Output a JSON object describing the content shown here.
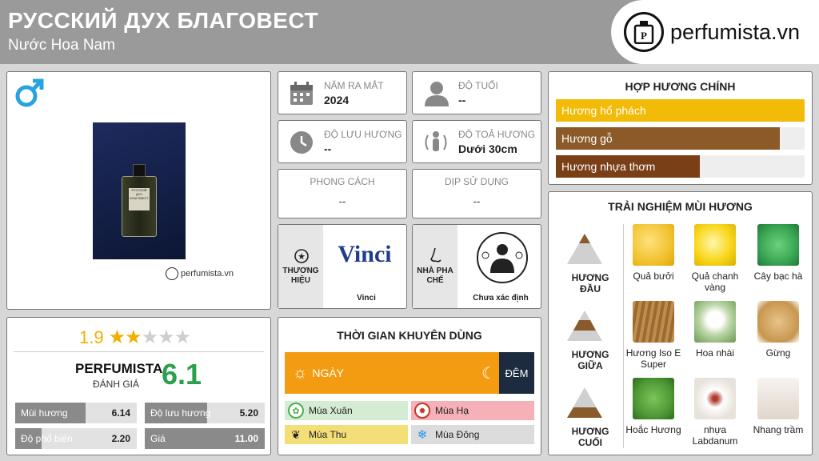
{
  "header": {
    "title": "РУССКИЙ ДУХ БЛАГОВЕСТ",
    "subtitle": "Nước Hoa Nam",
    "brand": "perfumista.vn"
  },
  "product": {
    "gender_icon": "male-symbol",
    "watermark": "perfumista.vn",
    "bottle_label": "РУССКИЙ ДУХ БЛАГОВЕСТ"
  },
  "info": {
    "release": {
      "label": "NĂM RA MẮT",
      "value": "2024"
    },
    "age": {
      "label": "ĐỘ TUỔI",
      "value": "--"
    },
    "longevity": {
      "label": "ĐỘ LƯU HƯƠNG",
      "value": "--"
    },
    "sillage": {
      "label": "ĐỘ TOẢ HƯƠNG",
      "value": "Dưới 30cm"
    },
    "style": {
      "label": "PHONG CÁCH",
      "value": "--"
    },
    "occasion": {
      "label": "DỊP SỬ DỤNG",
      "value": "--"
    },
    "brand": {
      "label": "THƯƠNG HIỆU",
      "name": "Vinci",
      "logo_text": "Vinci"
    },
    "perfumer": {
      "label": "NHÀ PHA CHẾ",
      "name": "Chưa xác định"
    }
  },
  "rating": {
    "score": "1.9",
    "stars": 1.9,
    "perfumista_label": "PERFUMISTA",
    "perfumista_sub": "ĐÁNH GIÁ",
    "perfumista_score": "6.1",
    "metrics": [
      {
        "label": "Mùi hương",
        "value": "6.14",
        "fraction": 0.614
      },
      {
        "label": "Độ lưu hương",
        "value": "5.20",
        "fraction": 0.52
      },
      {
        "label": "Độ phổ biến",
        "value": "2.20",
        "fraction": 0.22
      },
      {
        "label": "Giá",
        "value": "11.00",
        "fraction": 1.0
      }
    ]
  },
  "timing": {
    "title": "THỜI GIAN KHUYÊN DÙNG",
    "day": "NGÀY",
    "night": "ĐÊM",
    "day_fraction": 0.85,
    "seasons": [
      {
        "label": "Mùa Xuân",
        "icon": "flower-icon",
        "color": "#d4ecd4",
        "ic": "#4caf50"
      },
      {
        "label": "Mùa Hạ",
        "icon": "sun-icon",
        "color": "#f5b0b8",
        "ic": "#c0392b"
      },
      {
        "label": "Mùa Thu",
        "icon": "leaf-icon",
        "color": "#f4de78",
        "ic": "#333"
      },
      {
        "label": "Mùa Đông",
        "icon": "snowflake-icon",
        "color": "#dcdcdc",
        "ic": "#2196f3"
      }
    ]
  },
  "accords": {
    "title": "HỢP HƯƠNG CHÍNH",
    "items": [
      {
        "label": "Hương hổ phách",
        "fraction": 1.0,
        "color": "#f2bb07"
      },
      {
        "label": "Hương gỗ",
        "fraction": 0.9,
        "color": "#8c5a28"
      },
      {
        "label": "Hương nhựa thơm",
        "fraction": 0.58,
        "color": "#7a3f17"
      }
    ]
  },
  "pyramid": {
    "title": "TRẢI NGHIỆM MÙI HƯƠNG",
    "tiers": [
      {
        "label": "HƯƠNG ĐẦU",
        "notes": [
          {
            "name": "Quả bưởi",
            "color": "#f1c232"
          },
          {
            "name": "Quả chanh vàng",
            "color": "#f9d71c"
          },
          {
            "name": "Cây bạc hà",
            "color": "#3aa655"
          }
        ]
      },
      {
        "label": "HƯƠNG GIỮA",
        "notes": [
          {
            "name": "Hương Iso E Super",
            "color": "#b5803e"
          },
          {
            "name": "Hoa nhài",
            "color": "#e8f0e0"
          },
          {
            "name": "Gừng",
            "color": "#d8ad6a"
          }
        ]
      },
      {
        "label": "HƯƠNG CUỐI",
        "notes": [
          {
            "name": "Hoắc Hương",
            "color": "#4f9a36"
          },
          {
            "name": "nhựa Labdanum",
            "color": "#f0ebe6"
          },
          {
            "name": "Nhang trầm",
            "color": "#e9e3de"
          }
        ]
      }
    ]
  }
}
